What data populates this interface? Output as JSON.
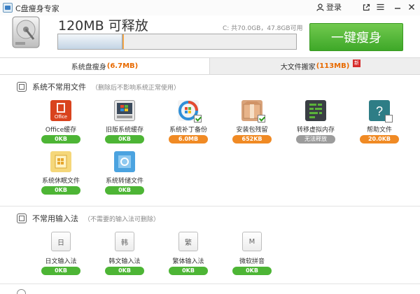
{
  "window": {
    "title": "C盘瘦身专家",
    "login_label": "登录"
  },
  "header": {
    "releasable": "120MB 可释放",
    "disk_info": "C: 共70.0GB，47.8GB可用",
    "used_fraction": 0.27,
    "release_fraction": 0.005,
    "slim_button": "一键瘦身"
  },
  "tabs": [
    {
      "label": "系统盘瘦身",
      "size": "(6.7MB)"
    },
    {
      "label": "大文件搬家",
      "size": "(113MB)",
      "badge": "新"
    }
  ],
  "sections": [
    {
      "title": "系统不常用文件",
      "note": "（删除后不影响系统正常使用）",
      "items": [
        {
          "label": "Office缓存",
          "size": "0KB",
          "status": "green",
          "icon": "office-icon"
        },
        {
          "label": "旧版系统缓存",
          "size": "0KB",
          "status": "green",
          "icon": "old-windows-icon"
        },
        {
          "label": "系统补丁备份",
          "size": "6.0MB",
          "status": "orange",
          "icon": "windows-update-icon"
        },
        {
          "label": "安装包残留",
          "size": "652KB",
          "status": "orange",
          "icon": "package-icon"
        },
        {
          "label": "转移虚拟内存",
          "size": "无法释放",
          "status": "gray",
          "icon": "memory-icon"
        },
        {
          "label": "帮助文件",
          "size": "20.0KB",
          "status": "orange",
          "icon": "help-icon"
        },
        {
          "label": "系统休眠文件",
          "size": "0KB",
          "status": "green",
          "icon": "hibernate-file-icon"
        },
        {
          "label": "系统转储文件",
          "size": "0KB",
          "status": "green",
          "icon": "dump-file-icon"
        }
      ]
    },
    {
      "title": "不常用输入法",
      "note": "（不需要的输入法可删除）",
      "items": [
        {
          "label": "日文输入法",
          "size": "0KB",
          "glyph": "日"
        },
        {
          "label": "韩文输入法",
          "size": "0KB",
          "glyph": "韩"
        },
        {
          "label": "繁体输入法",
          "size": "0KB",
          "glyph": "繁"
        },
        {
          "label": "微软拼音",
          "size": "0KB",
          "glyph": "M"
        }
      ]
    }
  ],
  "colors": {
    "accent_green": "#4db535",
    "accent_orange": "#f08a24",
    "tab_size": "#e86a00"
  }
}
